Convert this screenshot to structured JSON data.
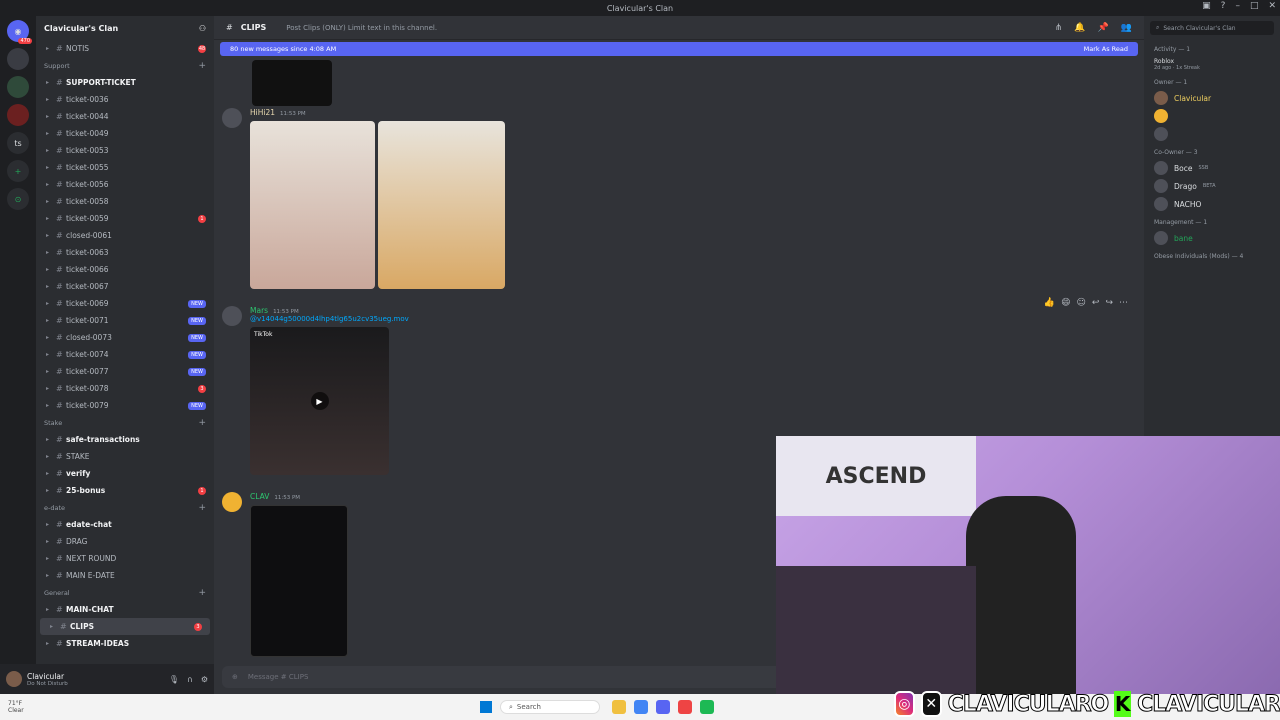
{
  "window": {
    "title": "Clavicular's Clan"
  },
  "servers": {
    "items": [
      "470",
      "",
      "",
      "",
      "ts",
      "+",
      ""
    ],
    "badge": "470"
  },
  "guild": {
    "name": "Clavicular's Clan"
  },
  "channels": {
    "top": [
      {
        "name": "NOTIS",
        "count": "48"
      }
    ],
    "support_cat": "Support",
    "support": [
      {
        "name": "SUPPORT-TICKET",
        "bold": true
      },
      {
        "name": "ticket-0036"
      },
      {
        "name": "ticket-0044"
      },
      {
        "name": "ticket-0049"
      },
      {
        "name": "ticket-0053"
      },
      {
        "name": "ticket-0055"
      },
      {
        "name": "ticket-0056"
      },
      {
        "name": "ticket-0058"
      },
      {
        "name": "ticket-0059",
        "count": "1"
      },
      {
        "name": "closed-0061"
      },
      {
        "name": "ticket-0063"
      },
      {
        "name": "ticket-0066"
      },
      {
        "name": "ticket-0067"
      },
      {
        "name": "ticket-0069",
        "new": "NEW"
      },
      {
        "name": "ticket-0071",
        "new": "NEW"
      },
      {
        "name": "closed-0073",
        "new": "NEW"
      },
      {
        "name": "ticket-0074",
        "new": "NEW"
      },
      {
        "name": "ticket-0077",
        "new": "NEW"
      },
      {
        "name": "ticket-0078",
        "count": "3"
      },
      {
        "name": "ticket-0079",
        "new": "NEW"
      }
    ],
    "stake_cat": "Stake",
    "stake": [
      {
        "name": "safe-transactions",
        "bold": true
      },
      {
        "name": "STAKE"
      },
      {
        "name": "verify",
        "bold": true
      },
      {
        "name": "25-bonus",
        "bold": true,
        "count": "1"
      }
    ],
    "edate_cat": "e-date",
    "edate": [
      {
        "name": "edate-chat",
        "bold": true
      },
      {
        "name": "DRAG"
      },
      {
        "name": "NEXT ROUND"
      },
      {
        "name": "MAIN E-DATE"
      }
    ],
    "general_cat": "General",
    "general": [
      {
        "name": "MAIN-CHAT",
        "bold": true
      },
      {
        "name": "CLIPS",
        "bold": true,
        "active": true,
        "count": "3"
      },
      {
        "name": "STREAM-IDEAS",
        "bold": true
      }
    ]
  },
  "user": {
    "name": "Clavicular",
    "status": "Do Not Disturb"
  },
  "header": {
    "channel": "CLIPS",
    "topic": "Post Clips (ONLY) Limit text in this channel."
  },
  "newbar": {
    "text": "80 new messages since 4:08 AM",
    "action": "Mark As Read"
  },
  "messages": [
    {
      "author": "HiHi21",
      "time": "11:53 PM"
    },
    {
      "author": "Mars",
      "time": "11:53 PM",
      "link": "@v14044g50000d4lhp4tlg65u2cv35ueg.mov",
      "tiktok": "TikTok"
    },
    {
      "author": "CLAV",
      "time": "11:53 PM"
    }
  ],
  "composer": {
    "placeholder": "Message # CLIPS"
  },
  "members": {
    "search": "Search Clavicular's Clan",
    "activity_cat": "Activity — 1",
    "activity": {
      "name": "Roblox",
      "detail": "2d ago · 1x Streak"
    },
    "owner_cat": "Owner — 1",
    "owner": "Clavicular",
    "coowner_cat": "Co-Owner — 3",
    "coowners": [
      {
        "name": "Boce",
        "tag": "SSB"
      },
      {
        "name": "Drago",
        "tag": "BETA"
      },
      {
        "name": "NACHO",
        "tag": ""
      }
    ],
    "mgmt_cat": "Management — 1",
    "mgmt": "bane",
    "mods_cat": "Obese Individuals (Mods) — 4"
  },
  "taskbar": {
    "weather_temp": "71°F",
    "weather_desc": "Clear",
    "search": "Search"
  },
  "overlay": {
    "handle1": "CLAVICULARO",
    "handle2": "CLAVICULAR",
    "kick": "K"
  },
  "webcam": {
    "poster": "ASCEND"
  }
}
